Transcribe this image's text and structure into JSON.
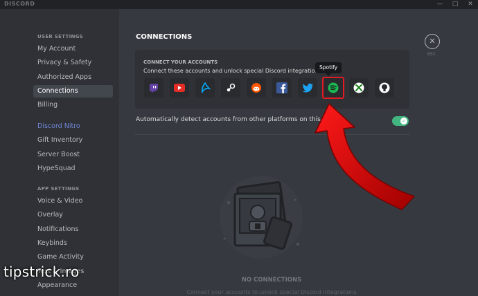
{
  "window": {
    "brand": "DISCORD",
    "minimize": "—",
    "maximize": "□",
    "close": "✕"
  },
  "sidebar": {
    "user_settings_header": "USER SETTINGS",
    "user_items": [
      {
        "label": "My Account"
      },
      {
        "label": "Privacy & Safety"
      },
      {
        "label": "Authorized Apps"
      },
      {
        "label": "Connections"
      },
      {
        "label": "Billing"
      }
    ],
    "nitro_items": [
      {
        "label": "Discord Nitro"
      },
      {
        "label": "Gift Inventory"
      },
      {
        "label": "Server Boost"
      },
      {
        "label": "HypeSquad"
      }
    ],
    "app_settings_header": "APP SETTINGS",
    "app_items": [
      {
        "label": "Voice & Video"
      },
      {
        "label": "Overlay"
      },
      {
        "label": "Notifications"
      },
      {
        "label": "Keybinds"
      },
      {
        "label": "Game Activity"
      },
      {
        "label": "Text & Images"
      },
      {
        "label": "Appearance"
      }
    ]
  },
  "main": {
    "title": "CONNECTIONS",
    "connect_header": "CONNECT YOUR ACCOUNTS",
    "connect_sub": "Connect these accounts and unlock special Discord integrations.",
    "tooltip": "Spotify",
    "services": [
      {
        "icon": "twitch-icon",
        "color": "#6441a5"
      },
      {
        "icon": "youtube-icon",
        "color": "#e52d27"
      },
      {
        "icon": "battlenet-icon",
        "color": "#00aeff"
      },
      {
        "icon": "steam-icon",
        "color": "#ffffff"
      },
      {
        "icon": "reddit-icon",
        "color": "#ff5700"
      },
      {
        "icon": "facebook-icon",
        "color": "#3b5998"
      },
      {
        "icon": "twitter-icon",
        "color": "#1da1f2"
      },
      {
        "icon": "spotify-icon",
        "color": "#1db954"
      },
      {
        "icon": "xbox-icon",
        "color": "#ffffff"
      },
      {
        "icon": "github-icon",
        "color": "#ffffff"
      }
    ],
    "detect_label": "Automatically detect accounts from other platforms on this comput",
    "toggle_on": true,
    "esc_label": "ESC",
    "empty_title": "NO CONNECTIONS",
    "empty_sub": "Connect your accounts to unlock special Discord integrations"
  },
  "overlay": {
    "watermark": "tipstrick.ro",
    "arrow_color": "#e00000"
  }
}
